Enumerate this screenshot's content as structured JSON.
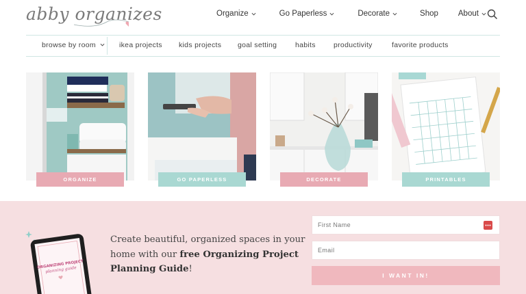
{
  "brand": {
    "logo_text": "abby organizes"
  },
  "main_nav": [
    {
      "label": "Organize",
      "has_menu": true
    },
    {
      "label": "Go Paperless",
      "has_menu": true
    },
    {
      "label": "Decorate",
      "has_menu": true
    },
    {
      "label": "Shop",
      "has_menu": false
    },
    {
      "label": "About",
      "has_menu": true
    }
  ],
  "sub_nav": {
    "browse_label": "browse by room",
    "links": [
      "ikea projects",
      "kids projects",
      "goal setting",
      "habits",
      "productivity",
      "favorite products"
    ]
  },
  "tiles": [
    {
      "label": "ORGANIZE",
      "color": "#e8aab3"
    },
    {
      "label": "GO PAPERLESS",
      "color": "#a9d8d2"
    },
    {
      "label": "DECORATE",
      "color": "#e8aab3"
    },
    {
      "label": "PRINTABLES",
      "color": "#a9d8d2"
    }
  ],
  "optin": {
    "text_plain": "Create beautiful, organized spaces in your home with our ",
    "text_bold": "free Organizing Project Planning Guide",
    "text_end": "!",
    "ebook_title": "ORGANIZING PROJECT",
    "ebook_subtitle": "planning guide",
    "first_name_placeholder": "First Name",
    "email_placeholder": "Email",
    "submit_label": "I WANT IN!"
  },
  "colors": {
    "band": "#f6dfe1",
    "accent_pink": "#e8aab3",
    "accent_teal": "#a9d8d2",
    "button": "#f0b8be"
  }
}
